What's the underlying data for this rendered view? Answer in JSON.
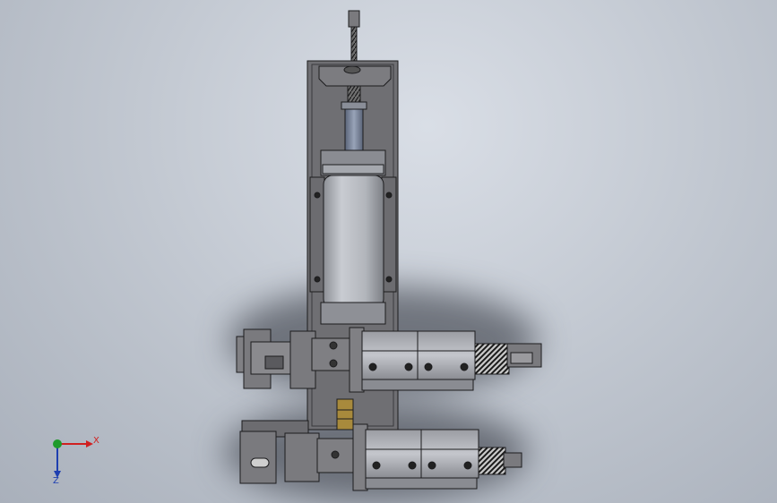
{
  "viewport": {
    "background_top": "#d9dee6",
    "background_bottom": "#a9b0bb"
  },
  "model": {
    "body_color": "#6f6f73",
    "edge_color": "#1c1c1e",
    "cylinder_color": "#b9bcc2",
    "rod_color": "#7f8aa0",
    "brass_color": "#a88a3c"
  },
  "triad": {
    "x_label": "X",
    "z_label": "Z",
    "x_color": "#d02020",
    "y_color": "#1f9a2a",
    "z_color": "#1e3fb0"
  }
}
